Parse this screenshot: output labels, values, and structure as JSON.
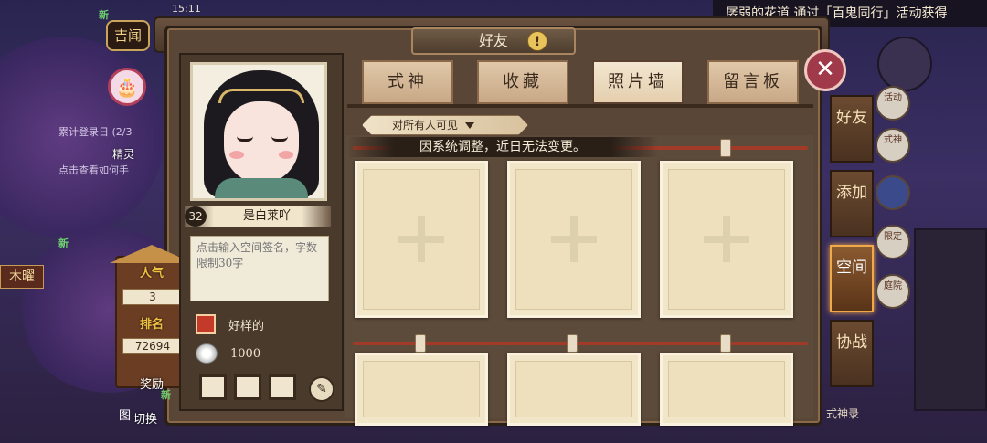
{
  "status": {
    "time": "15:11"
  },
  "marquee": "孱弱的花道 通过「百鬼同行」活动获得",
  "left_overlay": {
    "jiwen": "吉闻",
    "jingling": "精灵",
    "task_lines": [
      "累计登录日 (2/3",
      "点击查看如何手"
    ],
    "new_tag": "新",
    "day_label": "木曜",
    "reward": "奖励",
    "switch": "切换",
    "tu": "图"
  },
  "stats": {
    "popularity_label": "人气",
    "popularity_value": "3",
    "rank_label": "排名",
    "rank_value": "72694"
  },
  "window": {
    "title": "好友",
    "warn": "!"
  },
  "profile": {
    "level": "32",
    "name": "是白莱吖",
    "signature_placeholder": "点击输入空间签名，字数限制30字",
    "preference": "好样的",
    "coins": "1000"
  },
  "tabs": [
    {
      "label": "式神",
      "active": false
    },
    {
      "label": "收藏",
      "active": false
    },
    {
      "label": "照片墙",
      "active": true
    },
    {
      "label": "留言板",
      "active": false
    }
  ],
  "privacy": {
    "selected": "对所有人可见"
  },
  "notice": "因系统调整，近日无法变更。",
  "side_tabs": [
    {
      "label": "好友",
      "active": false
    },
    {
      "label": "添加",
      "active": false
    },
    {
      "label": "空间",
      "active": true
    },
    {
      "label": "协战",
      "active": false
    }
  ],
  "right_icons": [
    "活动",
    "式神",
    "",
    "限定",
    "庭院"
  ],
  "shishen_lu": "式神录",
  "colors": {
    "accent": "#f0a848",
    "close": "#a03a4a",
    "rope": "#a23a28"
  }
}
